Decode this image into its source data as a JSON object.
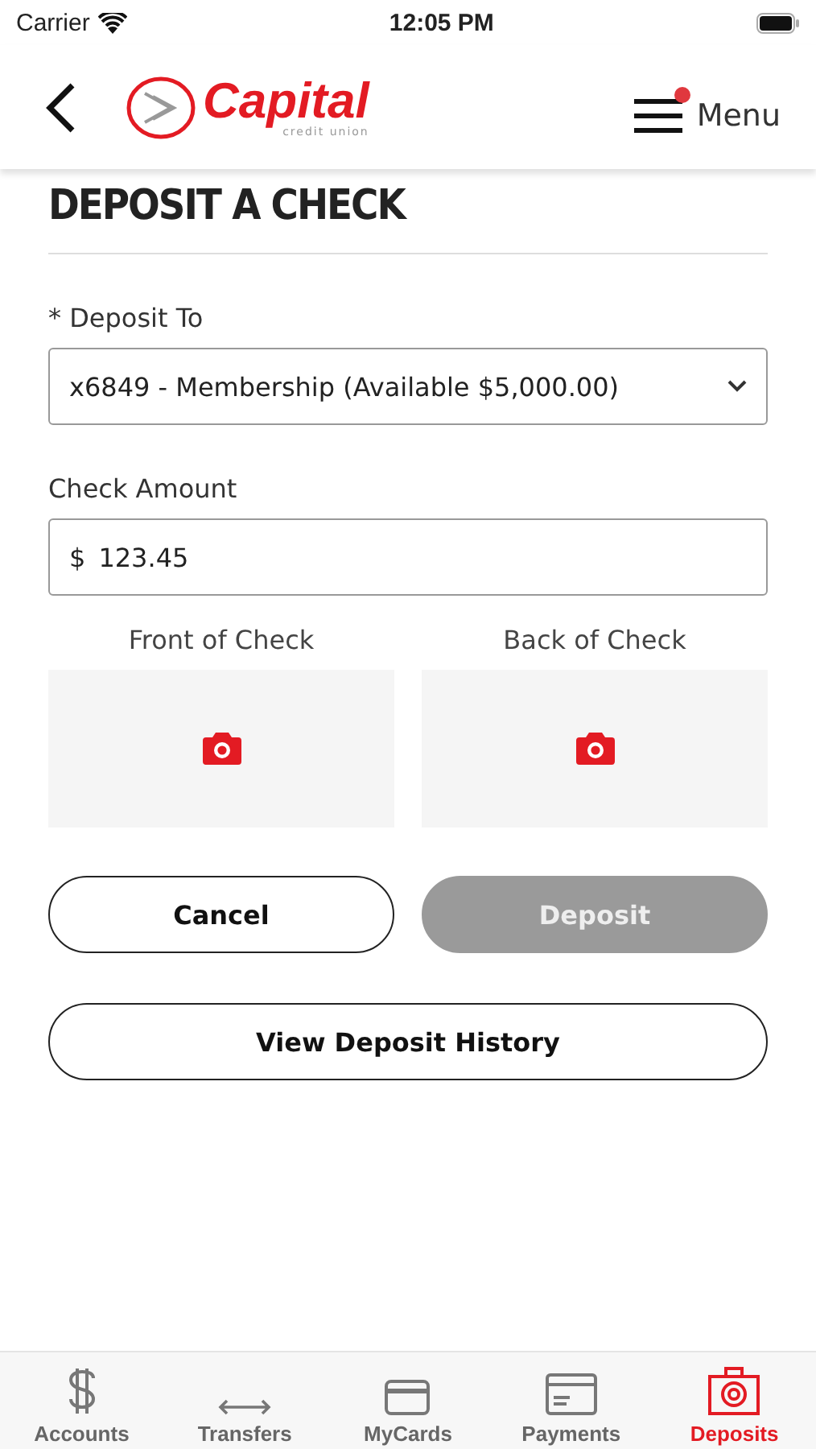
{
  "status_bar": {
    "carrier": "Carrier",
    "time": "12:05 PM"
  },
  "header": {
    "logo_name": "Capital",
    "logo_tagline": "credit union",
    "menu_label": "Menu",
    "menu_notification": true
  },
  "title": "DEPOSIT A CHECK",
  "deposit_to": {
    "label": "* Deposit To",
    "value": "x6849 - Membership (Available $5,000.00)"
  },
  "check_amount": {
    "label": "Check Amount",
    "currency": "$",
    "value": "123.45"
  },
  "captures": [
    {
      "label": "Front of Check"
    },
    {
      "label": "Back of Check"
    }
  ],
  "buttons": [
    {
      "label": "Cancel",
      "kind": "outline",
      "disabled": false
    },
    {
      "label": "Deposit",
      "kind": "filled",
      "disabled": true
    }
  ],
  "history_button": {
    "label": "View Deposit History"
  },
  "tabs": [
    {
      "label": "Accounts",
      "kind": "dollar",
      "selected": false
    },
    {
      "label": "Transfers",
      "kind": "arrows",
      "selected": false
    },
    {
      "label": "MyCards",
      "kind": "card",
      "selected": false
    },
    {
      "label": "Payments",
      "kind": "bill",
      "selected": false
    },
    {
      "label": "Deposits",
      "kind": "camera",
      "selected": true
    }
  ]
}
